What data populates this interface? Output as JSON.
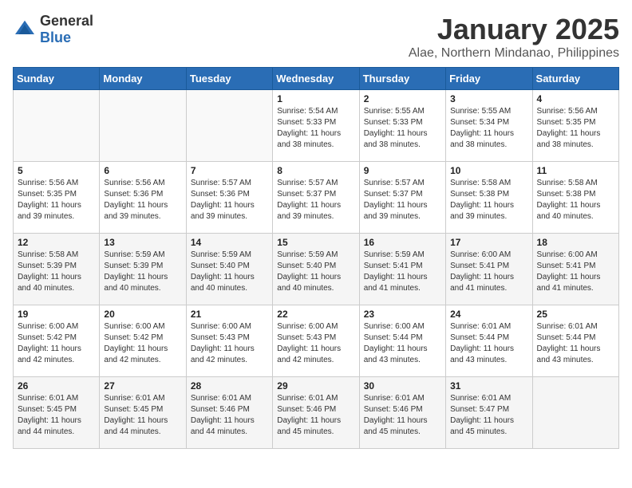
{
  "header": {
    "logo_general": "General",
    "logo_blue": "Blue",
    "month": "January 2025",
    "location": "Alae, Northern Mindanao, Philippines"
  },
  "days_of_week": [
    "Sunday",
    "Monday",
    "Tuesday",
    "Wednesday",
    "Thursday",
    "Friday",
    "Saturday"
  ],
  "weeks": [
    [
      {
        "day": "",
        "info": ""
      },
      {
        "day": "",
        "info": ""
      },
      {
        "day": "",
        "info": ""
      },
      {
        "day": "1",
        "info": "Sunrise: 5:54 AM\nSunset: 5:33 PM\nDaylight: 11 hours and 38 minutes."
      },
      {
        "day": "2",
        "info": "Sunrise: 5:55 AM\nSunset: 5:33 PM\nDaylight: 11 hours and 38 minutes."
      },
      {
        "day": "3",
        "info": "Sunrise: 5:55 AM\nSunset: 5:34 PM\nDaylight: 11 hours and 38 minutes."
      },
      {
        "day": "4",
        "info": "Sunrise: 5:56 AM\nSunset: 5:35 PM\nDaylight: 11 hours and 38 minutes."
      }
    ],
    [
      {
        "day": "5",
        "info": "Sunrise: 5:56 AM\nSunset: 5:35 PM\nDaylight: 11 hours and 39 minutes."
      },
      {
        "day": "6",
        "info": "Sunrise: 5:56 AM\nSunset: 5:36 PM\nDaylight: 11 hours and 39 minutes."
      },
      {
        "day": "7",
        "info": "Sunrise: 5:57 AM\nSunset: 5:36 PM\nDaylight: 11 hours and 39 minutes."
      },
      {
        "day": "8",
        "info": "Sunrise: 5:57 AM\nSunset: 5:37 PM\nDaylight: 11 hours and 39 minutes."
      },
      {
        "day": "9",
        "info": "Sunrise: 5:57 AM\nSunset: 5:37 PM\nDaylight: 11 hours and 39 minutes."
      },
      {
        "day": "10",
        "info": "Sunrise: 5:58 AM\nSunset: 5:38 PM\nDaylight: 11 hours and 39 minutes."
      },
      {
        "day": "11",
        "info": "Sunrise: 5:58 AM\nSunset: 5:38 PM\nDaylight: 11 hours and 40 minutes."
      }
    ],
    [
      {
        "day": "12",
        "info": "Sunrise: 5:58 AM\nSunset: 5:39 PM\nDaylight: 11 hours and 40 minutes."
      },
      {
        "day": "13",
        "info": "Sunrise: 5:59 AM\nSunset: 5:39 PM\nDaylight: 11 hours and 40 minutes."
      },
      {
        "day": "14",
        "info": "Sunrise: 5:59 AM\nSunset: 5:40 PM\nDaylight: 11 hours and 40 minutes."
      },
      {
        "day": "15",
        "info": "Sunrise: 5:59 AM\nSunset: 5:40 PM\nDaylight: 11 hours and 40 minutes."
      },
      {
        "day": "16",
        "info": "Sunrise: 5:59 AM\nSunset: 5:41 PM\nDaylight: 11 hours and 41 minutes."
      },
      {
        "day": "17",
        "info": "Sunrise: 6:00 AM\nSunset: 5:41 PM\nDaylight: 11 hours and 41 minutes."
      },
      {
        "day": "18",
        "info": "Sunrise: 6:00 AM\nSunset: 5:41 PM\nDaylight: 11 hours and 41 minutes."
      }
    ],
    [
      {
        "day": "19",
        "info": "Sunrise: 6:00 AM\nSunset: 5:42 PM\nDaylight: 11 hours and 42 minutes."
      },
      {
        "day": "20",
        "info": "Sunrise: 6:00 AM\nSunset: 5:42 PM\nDaylight: 11 hours and 42 minutes."
      },
      {
        "day": "21",
        "info": "Sunrise: 6:00 AM\nSunset: 5:43 PM\nDaylight: 11 hours and 42 minutes."
      },
      {
        "day": "22",
        "info": "Sunrise: 6:00 AM\nSunset: 5:43 PM\nDaylight: 11 hours and 42 minutes."
      },
      {
        "day": "23",
        "info": "Sunrise: 6:00 AM\nSunset: 5:44 PM\nDaylight: 11 hours and 43 minutes."
      },
      {
        "day": "24",
        "info": "Sunrise: 6:01 AM\nSunset: 5:44 PM\nDaylight: 11 hours and 43 minutes."
      },
      {
        "day": "25",
        "info": "Sunrise: 6:01 AM\nSunset: 5:44 PM\nDaylight: 11 hours and 43 minutes."
      }
    ],
    [
      {
        "day": "26",
        "info": "Sunrise: 6:01 AM\nSunset: 5:45 PM\nDaylight: 11 hours and 44 minutes."
      },
      {
        "day": "27",
        "info": "Sunrise: 6:01 AM\nSunset: 5:45 PM\nDaylight: 11 hours and 44 minutes."
      },
      {
        "day": "28",
        "info": "Sunrise: 6:01 AM\nSunset: 5:46 PM\nDaylight: 11 hours and 44 minutes."
      },
      {
        "day": "29",
        "info": "Sunrise: 6:01 AM\nSunset: 5:46 PM\nDaylight: 11 hours and 45 minutes."
      },
      {
        "day": "30",
        "info": "Sunrise: 6:01 AM\nSunset: 5:46 PM\nDaylight: 11 hours and 45 minutes."
      },
      {
        "day": "31",
        "info": "Sunrise: 6:01 AM\nSunset: 5:47 PM\nDaylight: 11 hours and 45 minutes."
      },
      {
        "day": "",
        "info": ""
      }
    ]
  ]
}
